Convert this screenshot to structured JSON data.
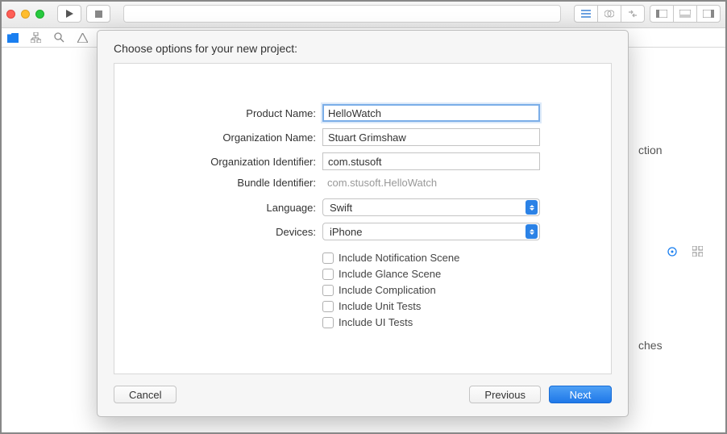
{
  "sheet": {
    "title": "Choose options for your new project:",
    "fields": {
      "product_name": {
        "label": "Product Name:",
        "value": "HelloWatch"
      },
      "org_name": {
        "label": "Organization Name:",
        "value": "Stuart Grimshaw"
      },
      "org_id": {
        "label": "Organization Identifier:",
        "value": "com.stusoft"
      },
      "bundle_id": {
        "label": "Bundle Identifier:",
        "value": "com.stusoft.HelloWatch"
      },
      "language": {
        "label": "Language:",
        "value": "Swift"
      },
      "devices": {
        "label": "Devices:",
        "value": "iPhone"
      }
    },
    "checkboxes": [
      "Include Notification Scene",
      "Include Glance Scene",
      "Include Complication",
      "Include Unit Tests",
      "Include UI Tests"
    ],
    "buttons": {
      "cancel": "Cancel",
      "previous": "Previous",
      "next": "Next"
    }
  },
  "bg": {
    "right_items": [
      "ction",
      "ches"
    ]
  }
}
